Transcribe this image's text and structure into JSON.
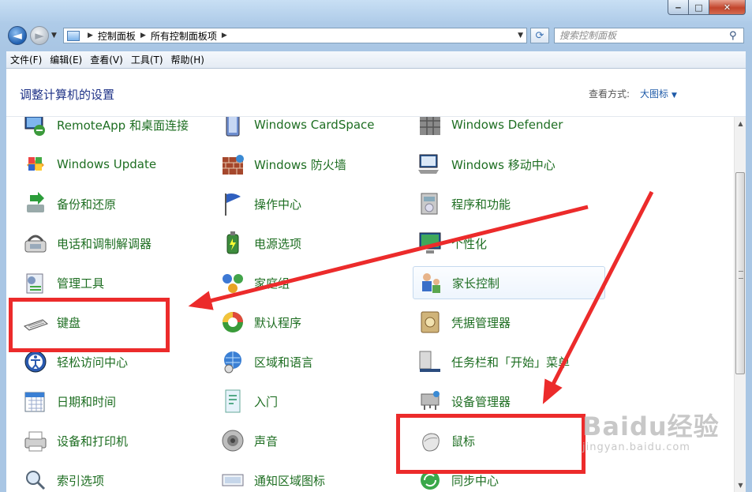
{
  "window": {
    "caption_minimize": "‒",
    "caption_maximize": "□",
    "caption_close": "✕"
  },
  "nav": {
    "back_glyph": "◄",
    "forward_glyph": "►",
    "breadcrumb": [
      "控制面板",
      "所有控制面板项"
    ],
    "search_placeholder": "搜索控制面板"
  },
  "menubar": [
    "文件(F)",
    "编辑(E)",
    "查看(V)",
    "工具(T)",
    "帮助(H)"
  ],
  "header": {
    "title": "调整计算机的设置",
    "view_by_label": "查看方式:",
    "view_by_value": "大图标"
  },
  "items": [
    [
      "RemoteApp 和桌面连接",
      "Windows CardSpace",
      "Windows Defender"
    ],
    [
      "Windows Update",
      "Windows 防火墙",
      "Windows 移动中心"
    ],
    [
      "备份和还原",
      "操作中心",
      "程序和功能"
    ],
    [
      "电话和调制解调器",
      "电源选项",
      "个性化"
    ],
    [
      "管理工具",
      "家庭组",
      "家长控制"
    ],
    [
      "键盘",
      "默认程序",
      "凭据管理器"
    ],
    [
      "轻松访问中心",
      "区域和语言",
      "任务栏和「开始」菜单"
    ],
    [
      "日期和时间",
      "入门",
      "设备管理器"
    ],
    [
      "设备和打印机",
      "声音",
      "鼠标"
    ],
    [
      "索引选项",
      "通知区域图标",
      "同步中心"
    ]
  ],
  "icons": [
    [
      "remote-desktop-icon",
      "cardspace-icon",
      "defender-icon"
    ],
    [
      "windows-update-icon",
      "firewall-icon",
      "mobility-center-icon"
    ],
    [
      "backup-restore-icon",
      "action-center-flag-icon",
      "programs-features-icon"
    ],
    [
      "phone-modem-icon",
      "power-options-icon",
      "personalization-icon"
    ],
    [
      "admin-tools-icon",
      "homegroup-icon",
      "parental-controls-icon"
    ],
    [
      "keyboard-icon",
      "default-programs-icon",
      "credential-manager-icon"
    ],
    [
      "ease-of-access-icon",
      "region-language-icon",
      "taskbar-start-menu-icon"
    ],
    [
      "date-time-icon",
      "getting-started-icon",
      "device-manager-icon"
    ],
    [
      "devices-printers-icon",
      "sound-icon",
      "mouse-icon"
    ],
    [
      "indexing-options-icon",
      "notification-icons-icon",
      "sync-center-icon"
    ]
  ],
  "hovered_item": "家长控制",
  "highlighted_items": [
    "键盘",
    "鼠标"
  ],
  "colors": {
    "item_text": "#1e6e22",
    "title_text": "#1e3287",
    "annotation_red": "#ec2b2b"
  },
  "watermark": {
    "brand": "Baidu经验",
    "url": "jingyan.baidu.com"
  }
}
